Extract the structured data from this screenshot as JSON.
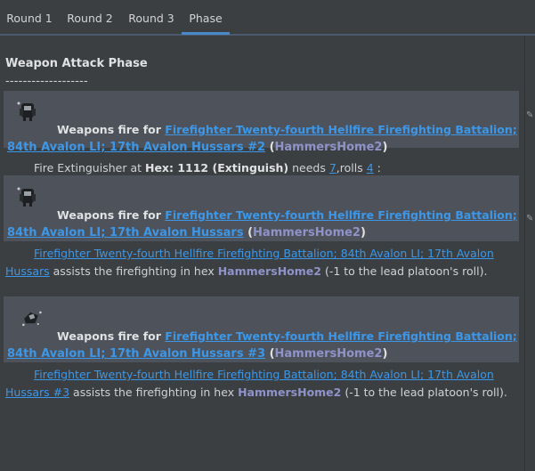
{
  "tabs": [
    {
      "label": "Round 1"
    },
    {
      "label": "Round 2"
    },
    {
      "label": "Round 3"
    },
    {
      "label": "Phase"
    }
  ],
  "phase": {
    "title": "Weapon Attack Phase",
    "separator": "-------------------"
  },
  "entries": [
    {
      "prefix": "Weapons fire for ",
      "unit_line1": "Firefighter Twenty-fourth Hellfire Firefighting Battalion;",
      "unit_line2": "84th Avalon LI; 17th Avalon Hussars #2",
      "owner_open": " (",
      "owner": "HammersHome2",
      "owner_close": ")",
      "detail": {
        "pre": "Fire Extinguisher at ",
        "hex": "Hex: 1112 (Extinguish)",
        "needs": " needs ",
        "needs_val": "7",
        "rolls": ",rolls ",
        "rolls_val": "4",
        "post": " :"
      }
    },
    {
      "prefix": "Weapons fire for ",
      "unit_line1": "Firefighter Twenty-fourth Hellfire Firefighting Battalion;",
      "unit_line2": "84th Avalon LI; 17th Avalon Hussars",
      "owner_open": " (",
      "owner": "HammersHome2",
      "owner_close": ")",
      "assist": {
        "unit_line1": "Firefighter Twenty-fourth Hellfire Firefighting Battalion; 84th Avalon LI; 17th Avalon",
        "unit_line2": "Hussars",
        "text": " assists the firefighting in hex ",
        "hex": "HammersHome2",
        "tail": " (-1 to the lead platoon's roll)."
      }
    },
    {
      "prefix": "Weapons fire for ",
      "unit_line1": "Firefighter Twenty-fourth Hellfire Firefighting Battalion;",
      "unit_line2": "84th Avalon LI; 17th Avalon Hussars #3",
      "owner_open": " (",
      "owner": "HammersHome2",
      "owner_close": ")",
      "assist": {
        "unit_line1": "Firefighter Twenty-fourth Hellfire Firefighting Battalion; 84th Avalon LI; 17th Avalon",
        "unit_line2": "Hussars #3",
        "text": " assists the firefighting in hex ",
        "hex": "HammersHome2",
        "tail": " (-1 to the lead platoon's roll)."
      }
    }
  ]
}
